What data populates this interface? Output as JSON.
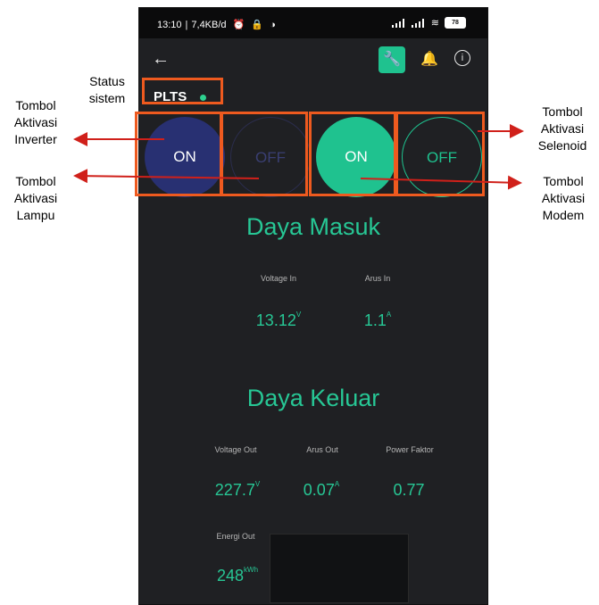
{
  "statusbar": {
    "time": "13:10",
    "netspeed": "7,4KB/d",
    "battery": "78"
  },
  "app": {
    "device_name": "PLTS"
  },
  "buttons": [
    "ON",
    "OFF",
    "ON",
    "OFF"
  ],
  "daya_masuk": {
    "title": "Daya Masuk",
    "voltage_label": "Voltage In",
    "voltage_value": "13.12",
    "voltage_unit": "V",
    "arus_label": "Arus In",
    "arus_value": "1.1",
    "arus_unit": "A"
  },
  "daya_keluar": {
    "title": "Daya Keluar",
    "voltage_label": "Voltage Out",
    "voltage_value": "227.7",
    "voltage_unit": "V",
    "arus_label": "Arus Out",
    "arus_value": "0.07",
    "arus_unit": "A",
    "pf_label": "Power Faktor",
    "pf_value": "0.77",
    "energi_label": "Energi Out",
    "energi_value": "248",
    "energi_unit": "kWh"
  },
  "annotations": {
    "status": [
      "Status",
      "sistem"
    ],
    "inverter": [
      "Tombol",
      "Aktivasi",
      "Inverter"
    ],
    "lampu": [
      "Tombol",
      "Aktivasi",
      "Lampu"
    ],
    "selenoid": [
      "Tombol",
      "Aktivasi",
      "Selenoid"
    ],
    "modem": [
      "Tombol",
      "Aktivasi",
      "Modem"
    ]
  },
  "colors": {
    "accent": "#1fc28f",
    "annotation_box": "#ee5a1f",
    "arrow": "#d0201a",
    "background": "#1f2023"
  }
}
